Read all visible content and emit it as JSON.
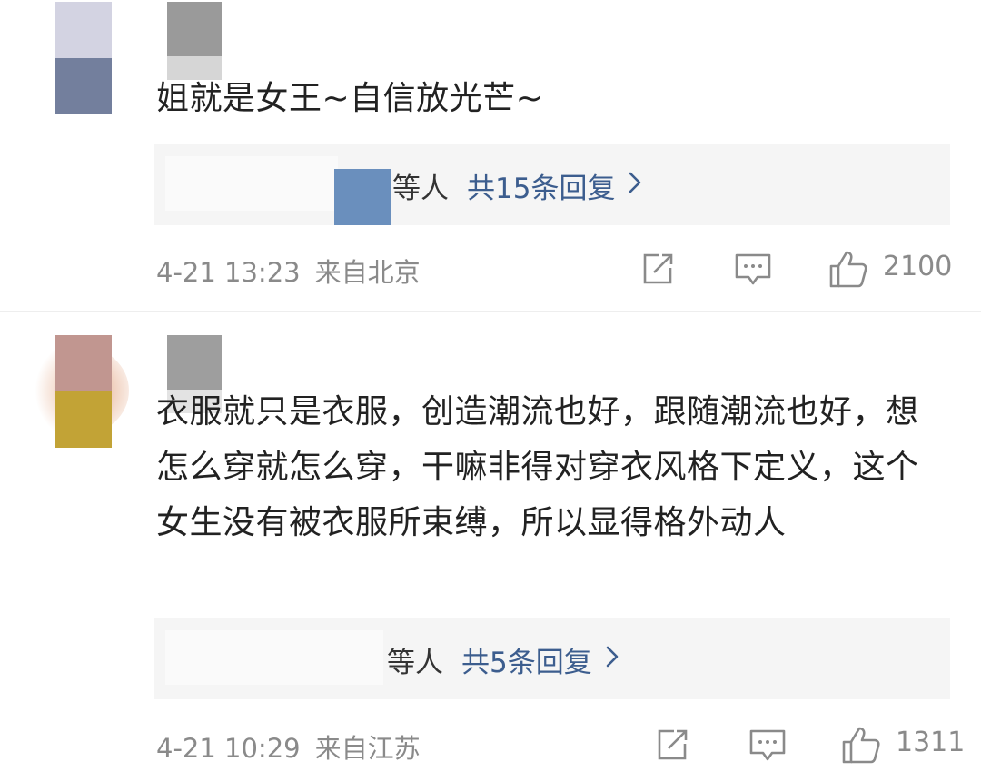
{
  "comments": [
    {
      "text": "姐就是女王~自信放光芒~",
      "reply_prefix": "等人",
      "reply_summary": "共15条回复",
      "time": "4-21 13:23",
      "location": "来自北京",
      "likes": "2100"
    },
    {
      "text": "衣服就只是衣服，创造潮流也好，跟随潮流也好，想怎么穿就怎么穿，干嘛非得对穿衣风格下定义，这个女生没有被衣服所束缚，所以显得格外动人",
      "reply_prefix": "等人",
      "reply_summary": "共5条回复",
      "time": "4-21 10:29",
      "location": "来自江苏",
      "likes": "1311"
    }
  ],
  "icons": {
    "share": "share-icon",
    "comment": "comment-icon",
    "like": "thumbs-up-icon",
    "chevron": "chevron-right-icon"
  },
  "colors": {
    "link": "#3c5d8e",
    "meta": "#8a8a8a",
    "reply_bg": "#f5f5f5"
  }
}
